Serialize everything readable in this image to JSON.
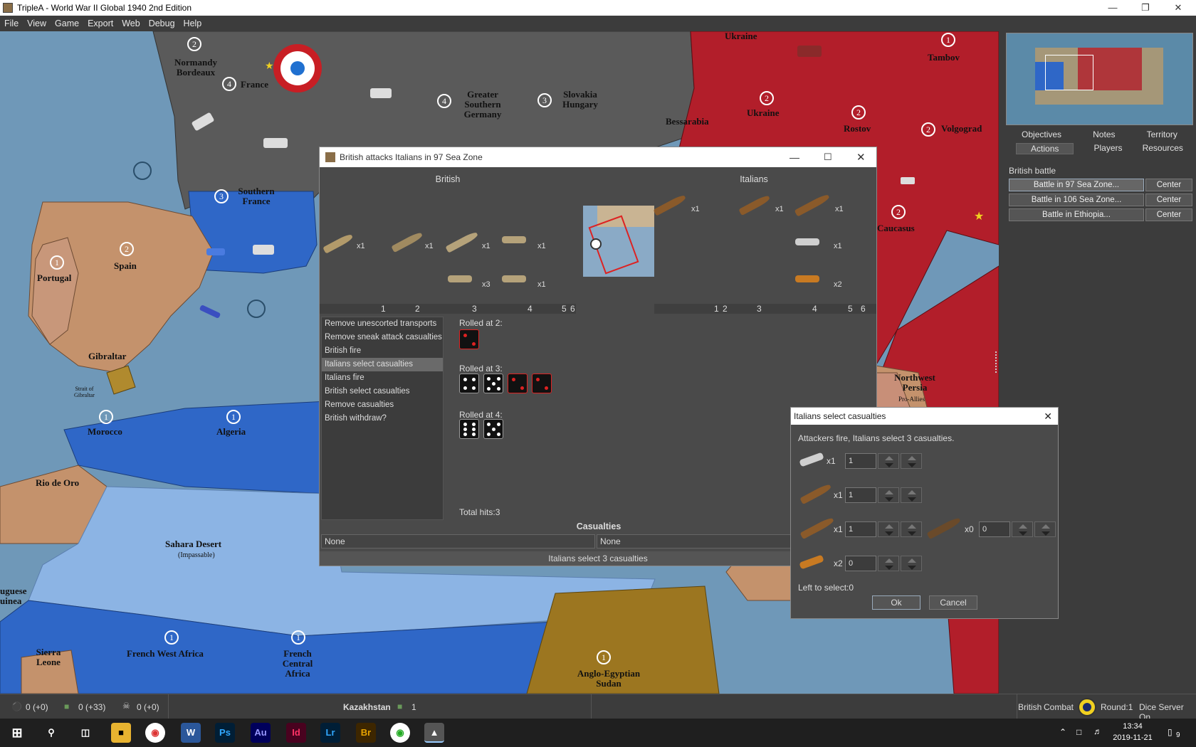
{
  "window": {
    "title": "TripleA - World War II Global 1940 2nd Edition"
  },
  "menu": [
    "File",
    "View",
    "Game",
    "Export",
    "Web",
    "Debug",
    "Help"
  ],
  "map": {
    "territories": [
      {
        "name": "Normandy\nBordeaux",
        "value": "2"
      },
      {
        "name": "France",
        "value": "4"
      },
      {
        "name": "Greater\nSouthern\nGermany",
        "value": "4"
      },
      {
        "name": "Slovakia\nHungary",
        "value": "3"
      },
      {
        "name": "Ukraine",
        "value": "2"
      },
      {
        "name": "Tambov",
        "value": "1"
      },
      {
        "name": "Bessarabia",
        "value": ""
      },
      {
        "name": "Rostov",
        "value": "2"
      },
      {
        "name": "Volgograd",
        "value": "2"
      },
      {
        "name": "Southern\nFrance",
        "value": "3"
      },
      {
        "name": "Caucasus",
        "value": "2"
      },
      {
        "name": "Portugal",
        "value": "1"
      },
      {
        "name": "Spain",
        "value": "2"
      },
      {
        "name": "Gibraltar",
        "value": ""
      },
      {
        "name": "Morocco",
        "value": "1"
      },
      {
        "name": "Algeria",
        "value": "1"
      },
      {
        "name": "Rio de Oro",
        "value": ""
      },
      {
        "name": "Sahara Desert",
        "value": ""
      },
      {
        "name": "French West Africa",
        "value": "1"
      },
      {
        "name": "French\nCentral\nAfrica",
        "value": "1"
      },
      {
        "name": "Anglo-Egyptian\nSudan",
        "value": "1"
      },
      {
        "name": "Sierra\nLeone",
        "value": ""
      },
      {
        "name": "Northwest\nPersia",
        "value": ""
      },
      {
        "name": "uguese\nuinea",
        "value": ""
      }
    ],
    "impassable": "(Impassable)",
    "strait": "Strait of\nGibraltar",
    "proallies": "Pro-Allies",
    "ukraine_top": "Ukraine"
  },
  "side": {
    "tabs_row1": [
      "Objectives",
      "Notes",
      "Territory"
    ],
    "tabs_row2": [
      "Actions",
      "Players",
      "Resources"
    ],
    "section": "British battle",
    "battles": [
      {
        "label": "Battle in 97 Sea Zone...",
        "center": "Center"
      },
      {
        "label": "Battle in 106 Sea Zone...",
        "center": "Center"
      },
      {
        "label": "Battle in Ethiopia...",
        "center": "Center"
      }
    ]
  },
  "battle": {
    "title": "British attacks Italians in 97 Sea Zone",
    "attacker": "British",
    "defender": "Italians",
    "att_units": [
      "x1",
      "x1",
      "x1",
      "x1",
      "x3",
      "x1"
    ],
    "def_units": [
      "x1",
      "x1",
      "x1",
      "x1",
      "x2"
    ],
    "att_axis": [
      "1",
      "2",
      "3",
      "4",
      "5",
      "6"
    ],
    "def_axis": [
      "1",
      "2",
      "3",
      "4",
      "5",
      "6"
    ],
    "steps": [
      "Remove unescorted transports",
      "Remove sneak attack casualties",
      "British fire",
      "Italians select casualties",
      "Italians fire",
      "British select casualties",
      "Remove casualties",
      "British withdraw?"
    ],
    "selected_step": 3,
    "rolls": [
      {
        "label": "Rolled at 2:",
        "dice": [
          {
            "v": 2,
            "hit": true
          }
        ]
      },
      {
        "label": "Rolled at 3:",
        "dice": [
          {
            "v": 4,
            "hit": false
          },
          {
            "v": 5,
            "hit": false
          },
          {
            "v": 2,
            "hit": true
          },
          {
            "v": 2,
            "hit": true
          }
        ]
      },
      {
        "label": "Rolled at 4:",
        "dice": [
          {
            "v": 6,
            "hit": false
          },
          {
            "v": 5,
            "hit": false
          }
        ]
      }
    ],
    "total_hits": "Total hits:3",
    "casualties_header": "Casualties",
    "cas_left": "None",
    "cas_right": "None",
    "status": "Italians select 3 casualties"
  },
  "cas": {
    "title": "Italians select casualties",
    "message": "Attackers fire, Italians select 3 casualties.",
    "rows": [
      {
        "count": "x1",
        "value": "1"
      },
      {
        "count": "x1",
        "value": "1"
      },
      {
        "count": "x1",
        "value": "1"
      },
      {
        "count": "x2",
        "value": "0"
      }
    ],
    "damaged": {
      "count": "x0",
      "value": "0"
    },
    "left": "Left to select:0",
    "ok": "Ok",
    "cancel": "Cancel"
  },
  "status": {
    "stat1": "0 (+0)",
    "stat2": "0 (+33)",
    "stat3": "0 (+0)",
    "territory": "Kazakhstan",
    "territory_val": "1",
    "player": "British",
    "phase": "Combat",
    "round": "Round:1",
    "dice": "Dice Server On"
  },
  "clock": {
    "time": "13:34",
    "date": "2019-11-21",
    "notif": "9"
  }
}
